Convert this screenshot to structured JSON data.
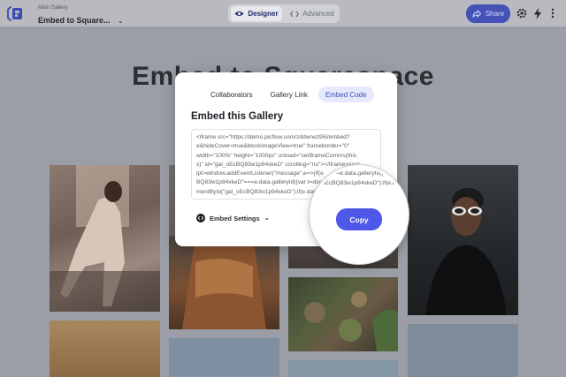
{
  "header": {
    "breadcrumb_small": "Main Gallery",
    "title": "Embed to Square...",
    "view_toggle": {
      "designer": "Designer",
      "advanced": "Advanced"
    },
    "share_label": "Share",
    "icons": [
      "logo-icon",
      "chevron-down-icon",
      "eye-icon",
      "code-icon",
      "share-icon",
      "gear-icon",
      "bolt-icon",
      "more-vertical-icon"
    ]
  },
  "gallery": {
    "title": "Embed to Squarespace"
  },
  "modal": {
    "tabs": [
      {
        "label": "Collaborators"
      },
      {
        "label": "Gallery Link"
      },
      {
        "label": "Embed Code"
      }
    ],
    "active_tab": "Embed Code",
    "heading": "Embed this Gallery",
    "code_lines": [
      "<iframe src=\"https://demo.picflow.com/zddwnez95l/embed?",
      "e&hideCover=true&blockImageView=true\" frameborder=\"0\"",
      "width=\"100%\" height=\"1000px\" onload=\"setIframeComms(this",
      "s)\" id=\"gal_oEcBQ83w1p94xkeD\" scrolling=\"no\"></iframe><scr",
      "ipt>window.addEventListener(\"message\",e=>{if(e",
      "BQ83w1p94xkeD\"===e.data.galleryId){var t=document.getEle",
      "mentById(\"gal_oEcBQ83w1p94xkeD\");if(e.data.hasOwnPrope"
    ],
    "embed_settings_label": "Embed Settings",
    "copy_label": "Copy"
  },
  "colors": {
    "accent": "#4f57e8",
    "share_button": "#4452b8",
    "active_tab_bg": "#e6e9fb"
  }
}
